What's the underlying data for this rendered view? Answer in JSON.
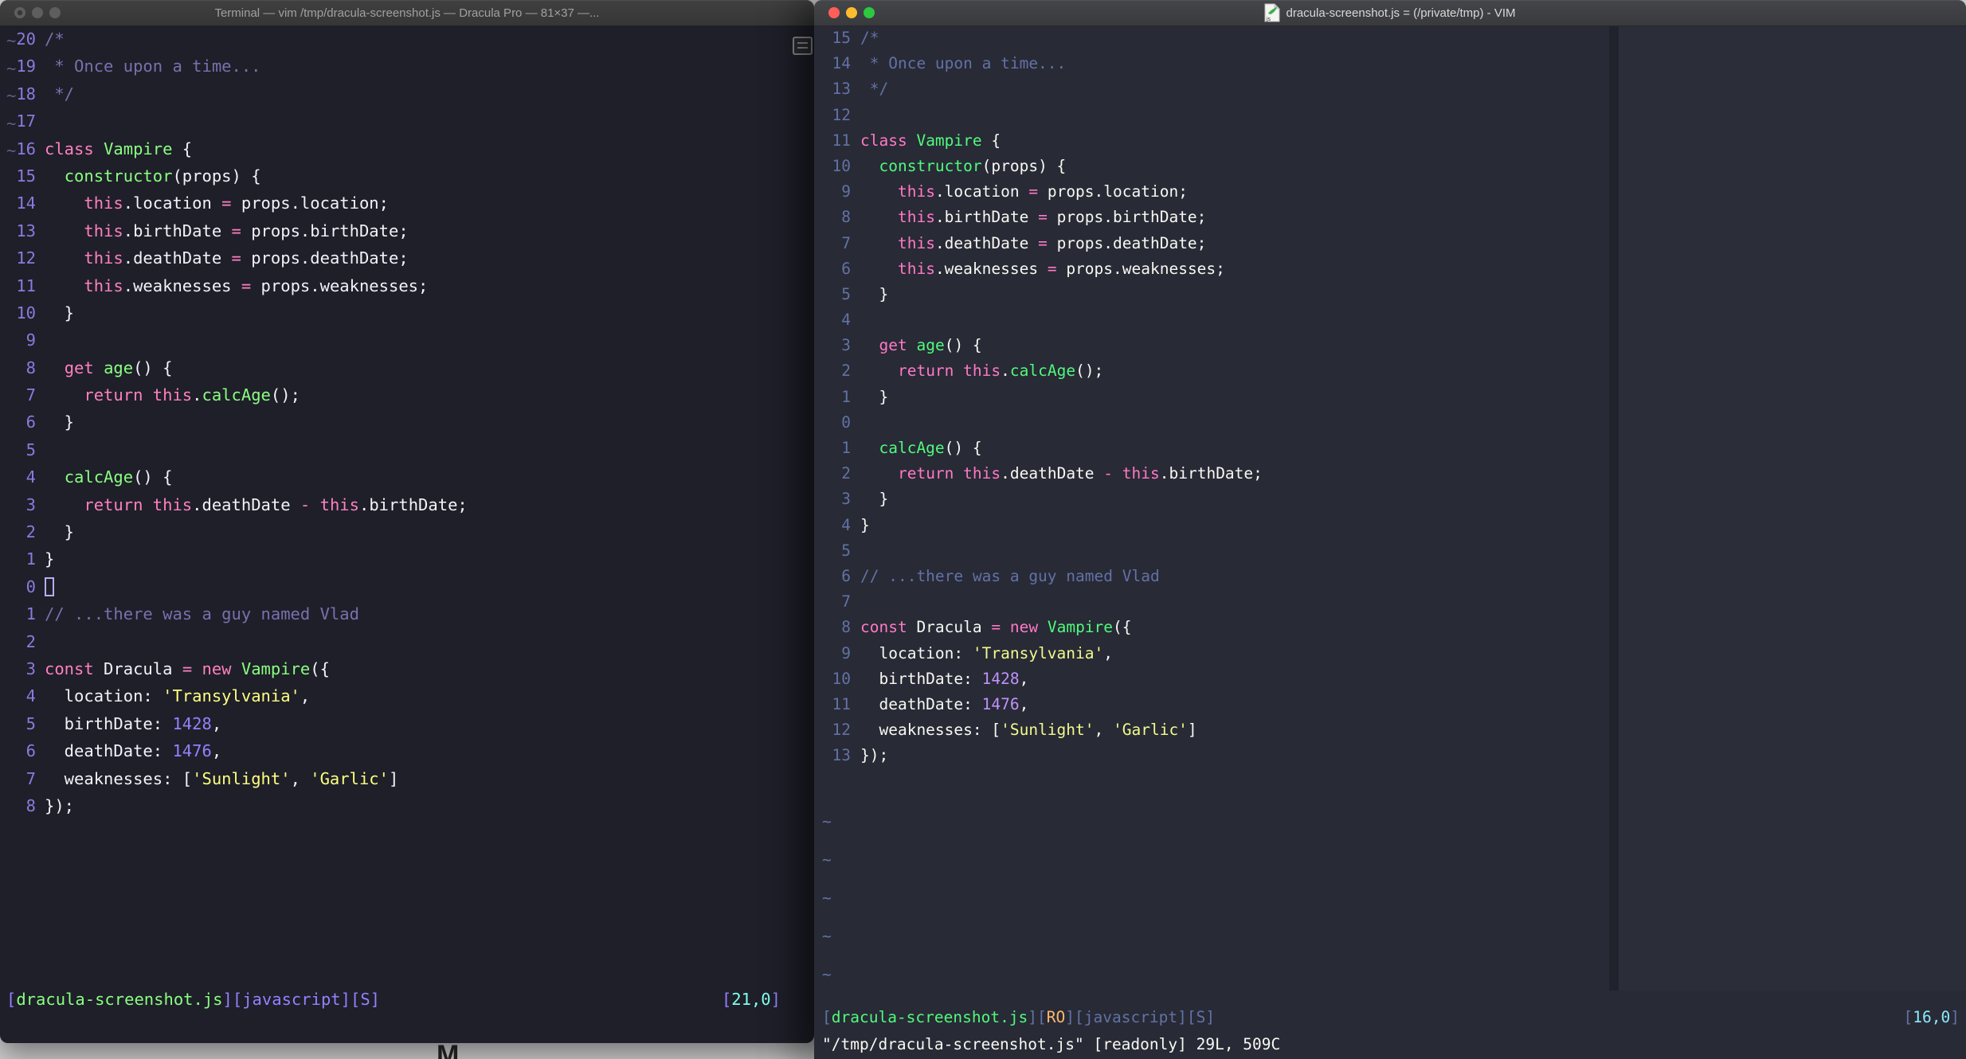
{
  "background_window": {
    "partial_text": "M"
  },
  "windows": {
    "left": {
      "app": "Terminal",
      "title": "Terminal — vim /tmp/dracula-screenshot.js — Dracula Pro — 81×37 —...",
      "active": false,
      "traffic_lights": [
        "close",
        "minimize",
        "zoom"
      ],
      "theme": {
        "name": "Dracula Pro",
        "bg": "#1e1f29",
        "f": "#f4f2f8",
        "p": "#ff80bf",
        "g": "#8aff80",
        "y": "#ffff80",
        "u": "#9580ff",
        "c": "#7b6fad",
        "cy": "#80ffea",
        "gutter": "#8d79dd",
        "tilde": "#625d85"
      },
      "lines": [
        {
          "n": "20",
          "s": [
            [
              "c",
              "/*"
            ]
          ]
        },
        {
          "n": "19",
          "s": [
            [
              "c",
              " * Once upon a time..."
            ]
          ]
        },
        {
          "n": "18",
          "s": [
            [
              "c",
              " */"
            ]
          ]
        },
        {
          "n": "17",
          "s": []
        },
        {
          "n": "16",
          "s": [
            [
              "p",
              "class"
            ],
            [
              "f",
              " "
            ],
            [
              "g",
              "Vampire"
            ],
            [
              "f",
              " {"
            ]
          ]
        },
        {
          "n": "15",
          "s": [
            [
              "f",
              "  "
            ],
            [
              "g",
              "constructor"
            ],
            [
              "f",
              "(props) {"
            ]
          ]
        },
        {
          "n": "14",
          "s": [
            [
              "f",
              "    "
            ],
            [
              "p",
              "this"
            ],
            [
              "f",
              ".location "
            ],
            [
              "p",
              "="
            ],
            [
              "f",
              " props.location;"
            ]
          ]
        },
        {
          "n": "13",
          "s": [
            [
              "f",
              "    "
            ],
            [
              "p",
              "this"
            ],
            [
              "f",
              ".birthDate "
            ],
            [
              "p",
              "="
            ],
            [
              "f",
              " props.birthDate;"
            ]
          ]
        },
        {
          "n": "12",
          "s": [
            [
              "f",
              "    "
            ],
            [
              "p",
              "this"
            ],
            [
              "f",
              ".deathDate "
            ],
            [
              "p",
              "="
            ],
            [
              "f",
              " props.deathDate;"
            ]
          ]
        },
        {
          "n": "11",
          "s": [
            [
              "f",
              "    "
            ],
            [
              "p",
              "this"
            ],
            [
              "f",
              ".weaknesses "
            ],
            [
              "p",
              "="
            ],
            [
              "f",
              " props.weaknesses;"
            ]
          ]
        },
        {
          "n": "10",
          "s": [
            [
              "f",
              "  }"
            ]
          ]
        },
        {
          "n": "9",
          "s": []
        },
        {
          "n": "8",
          "s": [
            [
              "f",
              "  "
            ],
            [
              "p",
              "get"
            ],
            [
              "f",
              " "
            ],
            [
              "g",
              "age"
            ],
            [
              "f",
              "() {"
            ]
          ]
        },
        {
          "n": "7",
          "s": [
            [
              "f",
              "    "
            ],
            [
              "p",
              "return"
            ],
            [
              "f",
              " "
            ],
            [
              "p",
              "this"
            ],
            [
              "f",
              "."
            ],
            [
              "g",
              "calcAge"
            ],
            [
              "f",
              "();"
            ]
          ]
        },
        {
          "n": "6",
          "s": [
            [
              "f",
              "  }"
            ]
          ]
        },
        {
          "n": "5",
          "s": []
        },
        {
          "n": "4",
          "s": [
            [
              "f",
              "  "
            ],
            [
              "g",
              "calcAge"
            ],
            [
              "f",
              "() {"
            ]
          ]
        },
        {
          "n": "3",
          "s": [
            [
              "f",
              "    "
            ],
            [
              "p",
              "return"
            ],
            [
              "f",
              " "
            ],
            [
              "p",
              "this"
            ],
            [
              "f",
              ".deathDate "
            ],
            [
              "p",
              "-"
            ],
            [
              "f",
              " "
            ],
            [
              "p",
              "this"
            ],
            [
              "f",
              ".birthDate;"
            ]
          ]
        },
        {
          "n": "2",
          "s": [
            [
              "f",
              "  }"
            ]
          ]
        },
        {
          "n": "1",
          "s": [
            [
              "f",
              "}"
            ]
          ]
        },
        {
          "n": "0",
          "cursor": true,
          "s": []
        },
        {
          "n": "1",
          "s": [
            [
              "c",
              "// ...there was a guy named Vlad"
            ]
          ]
        },
        {
          "n": "2",
          "s": []
        },
        {
          "n": "3",
          "s": [
            [
              "p",
              "const"
            ],
            [
              "f",
              " Dracula "
            ],
            [
              "p",
              "="
            ],
            [
              "f",
              " "
            ],
            [
              "p",
              "new"
            ],
            [
              "f",
              " "
            ],
            [
              "g",
              "Vampire"
            ],
            [
              "f",
              "({"
            ]
          ]
        },
        {
          "n": "4",
          "s": [
            [
              "f",
              "  location: "
            ],
            [
              "y",
              "'Transylvania'"
            ],
            [
              "f",
              ","
            ]
          ]
        },
        {
          "n": "5",
          "s": [
            [
              "f",
              "  birthDate: "
            ],
            [
              "u",
              "1428"
            ],
            [
              "f",
              ","
            ]
          ]
        },
        {
          "n": "6",
          "s": [
            [
              "f",
              "  deathDate: "
            ],
            [
              "u",
              "1476"
            ],
            [
              "f",
              ","
            ]
          ]
        },
        {
          "n": "7",
          "s": [
            [
              "f",
              "  weaknesses: ["
            ],
            [
              "y",
              "'Sunlight'"
            ],
            [
              "f",
              ", "
            ],
            [
              "y",
              "'Garlic'"
            ],
            [
              "f",
              "]"
            ]
          ]
        },
        {
          "n": "8",
          "s": [
            [
              "f",
              "});"
            ]
          ]
        }
      ],
      "tilde_char": "~",
      "tilde_count": 6,
      "status_left": [
        [
          "u",
          "["
        ],
        [
          "g",
          "dracula-screenshot.js"
        ],
        [
          "u",
          "]["
        ],
        [
          "u",
          "javascript"
        ],
        [
          "u",
          "]["
        ],
        [
          "u",
          "S"
        ],
        [
          "u",
          "]"
        ]
      ],
      "status_right": [
        [
          "u",
          "["
        ],
        [
          "cy",
          "21,0"
        ],
        [
          "u",
          "]"
        ]
      ]
    },
    "right": {
      "app": "VIM",
      "title": "dracula-screenshot.js = (/private/tmp) - VIM",
      "active": true,
      "traffic_lights": [
        "close",
        "minimize",
        "zoom"
      ],
      "traffic_colors": {
        "close": "#ff5f58",
        "minimize": "#febc2e",
        "zoom": "#2bc840"
      },
      "doc_icon": "javascript-document-icon",
      "theme": {
        "name": "Dracula",
        "bg": "#282a36",
        "f": "#f8f8f2",
        "p": "#ff79c6",
        "g": "#50fa7b",
        "y": "#f1fa8c",
        "u": "#bd93f9",
        "c": "#6272a4",
        "s": "#6272a4",
        "cy": "#8be9fd",
        "o": "#ffb86c",
        "gutter": "#6272a4",
        "tilde": "#6272a4"
      },
      "lines": [
        {
          "n": "15",
          "s": [
            [
              "c",
              "/*"
            ]
          ]
        },
        {
          "n": "14",
          "s": [
            [
              "c",
              " * Once upon a time..."
            ]
          ]
        },
        {
          "n": "13",
          "s": [
            [
              "c",
              " */"
            ]
          ]
        },
        {
          "n": "12",
          "s": []
        },
        {
          "n": "11",
          "s": [
            [
              "p",
              "class"
            ],
            [
              "f",
              " "
            ],
            [
              "g",
              "Vampire"
            ],
            [
              "f",
              " {"
            ]
          ]
        },
        {
          "n": "10",
          "s": [
            [
              "f",
              "  "
            ],
            [
              "g",
              "constructor"
            ],
            [
              "f",
              "(props) {"
            ]
          ]
        },
        {
          "n": "9",
          "s": [
            [
              "f",
              "    "
            ],
            [
              "p",
              "this"
            ],
            [
              "f",
              ".location "
            ],
            [
              "p",
              "="
            ],
            [
              "f",
              " props.location;"
            ]
          ]
        },
        {
          "n": "8",
          "s": [
            [
              "f",
              "    "
            ],
            [
              "p",
              "this"
            ],
            [
              "f",
              ".birthDate "
            ],
            [
              "p",
              "="
            ],
            [
              "f",
              " props.birthDate;"
            ]
          ]
        },
        {
          "n": "7",
          "s": [
            [
              "f",
              "    "
            ],
            [
              "p",
              "this"
            ],
            [
              "f",
              ".deathDate "
            ],
            [
              "p",
              "="
            ],
            [
              "f",
              " props.deathDate;"
            ]
          ]
        },
        {
          "n": "6",
          "s": [
            [
              "f",
              "    "
            ],
            [
              "p",
              "this"
            ],
            [
              "f",
              ".weaknesses "
            ],
            [
              "p",
              "="
            ],
            [
              "f",
              " props.weaknesses;"
            ]
          ]
        },
        {
          "n": "5",
          "s": [
            [
              "f",
              "  }"
            ]
          ]
        },
        {
          "n": "4",
          "s": []
        },
        {
          "n": "3",
          "s": [
            [
              "f",
              "  "
            ],
            [
              "p",
              "get"
            ],
            [
              "f",
              " "
            ],
            [
              "g",
              "age"
            ],
            [
              "f",
              "() {"
            ]
          ]
        },
        {
          "n": "2",
          "s": [
            [
              "f",
              "    "
            ],
            [
              "p",
              "return"
            ],
            [
              "f",
              " "
            ],
            [
              "p",
              "this"
            ],
            [
              "f",
              "."
            ],
            [
              "g",
              "calcAge"
            ],
            [
              "f",
              "();"
            ]
          ]
        },
        {
          "n": "1",
          "s": [
            [
              "f",
              "  }"
            ]
          ]
        },
        {
          "n": "0",
          "s": []
        },
        {
          "n": "1",
          "s": [
            [
              "f",
              "  "
            ],
            [
              "g",
              "calcAge"
            ],
            [
              "f",
              "() {"
            ]
          ]
        },
        {
          "n": "2",
          "s": [
            [
              "f",
              "    "
            ],
            [
              "p",
              "return"
            ],
            [
              "f",
              " "
            ],
            [
              "p",
              "this"
            ],
            [
              "f",
              ".deathDate "
            ],
            [
              "p",
              "-"
            ],
            [
              "f",
              " "
            ],
            [
              "p",
              "this"
            ],
            [
              "f",
              ".birthDate;"
            ]
          ]
        },
        {
          "n": "3",
          "s": [
            [
              "f",
              "  }"
            ]
          ]
        },
        {
          "n": "4",
          "s": [
            [
              "f",
              "}"
            ]
          ]
        },
        {
          "n": "5",
          "s": []
        },
        {
          "n": "6",
          "s": [
            [
              "c",
              "// ...there was a guy named Vlad"
            ]
          ]
        },
        {
          "n": "7",
          "s": []
        },
        {
          "n": "8",
          "s": [
            [
              "p",
              "const"
            ],
            [
              "f",
              " Dracula "
            ],
            [
              "p",
              "="
            ],
            [
              "f",
              " "
            ],
            [
              "p",
              "new"
            ],
            [
              "f",
              " "
            ],
            [
              "g",
              "Vampire"
            ],
            [
              "f",
              "({"
            ]
          ]
        },
        {
          "n": "9",
          "s": [
            [
              "f",
              "  location: "
            ],
            [
              "y",
              "'Transylvania'"
            ],
            [
              "f",
              ","
            ]
          ]
        },
        {
          "n": "10",
          "s": [
            [
              "f",
              "  birthDate: "
            ],
            [
              "u",
              "1428"
            ],
            [
              "f",
              ","
            ]
          ]
        },
        {
          "n": "11",
          "s": [
            [
              "f",
              "  deathDate: "
            ],
            [
              "u",
              "1476"
            ],
            [
              "f",
              ","
            ]
          ]
        },
        {
          "n": "12",
          "s": [
            [
              "f",
              "  weaknesses: ["
            ],
            [
              "y",
              "'Sunlight'"
            ],
            [
              "f",
              ", "
            ],
            [
              "y",
              "'Garlic'"
            ],
            [
              "f",
              "]"
            ]
          ]
        },
        {
          "n": "13",
          "s": [
            [
              "f",
              "});"
            ]
          ]
        }
      ],
      "tilde_char": "~",
      "tilde_count": 5,
      "status_left": [
        [
          "s",
          "["
        ],
        [
          "g",
          "dracula-screenshot.js"
        ],
        [
          "s",
          "]["
        ],
        [
          "o",
          "RO"
        ],
        [
          "s",
          "]["
        ],
        [
          "s",
          "javascript"
        ],
        [
          "s",
          "]["
        ],
        [
          "s",
          "S"
        ],
        [
          "s",
          "]"
        ]
      ],
      "status_right": [
        [
          "s",
          "["
        ],
        [
          "cy",
          "16,0"
        ],
        [
          "s",
          "]"
        ]
      ],
      "command_line": "\"/tmp/dracula-screenshot.js\" [readonly] 29L, 509C"
    }
  }
}
